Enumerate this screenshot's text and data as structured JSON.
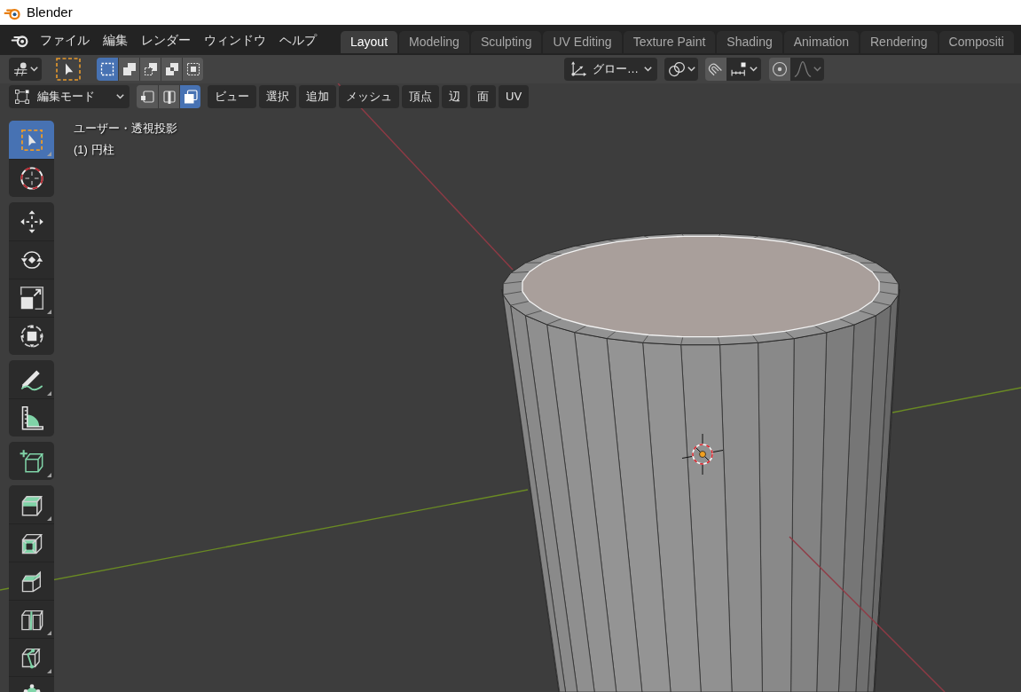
{
  "title_bar": {
    "title": "Blender"
  },
  "top_bar": {
    "menus": [
      "ファイル",
      "編集",
      "レンダー",
      "ウィンドウ",
      "ヘルプ"
    ],
    "workspace_tabs": [
      {
        "label": "Layout",
        "selected": true
      },
      {
        "label": "Modeling",
        "selected": false
      },
      {
        "label": "Sculpting",
        "selected": false
      },
      {
        "label": "UV Editing",
        "selected": false
      },
      {
        "label": "Texture Paint",
        "selected": false
      },
      {
        "label": "Shading",
        "selected": false
      },
      {
        "label": "Animation",
        "selected": false
      },
      {
        "label": "Rendering",
        "selected": false
      },
      {
        "label": "Compositi",
        "selected": false
      }
    ]
  },
  "tool_header": {
    "selection_modes": [
      {
        "kind": "new",
        "selected": true
      },
      {
        "kind": "extend",
        "selected": false
      },
      {
        "kind": "subtract",
        "selected": false
      },
      {
        "kind": "invert",
        "selected": false
      },
      {
        "kind": "intersect",
        "selected": false
      }
    ],
    "transform_orientation": {
      "value": "グロー…"
    },
    "snap": {
      "on": false
    },
    "proportional_editing": {
      "on": false
    },
    "proportional_falloff": {
      "disabled": true
    }
  },
  "view_header": {
    "mode": {
      "value": "編集モード"
    },
    "mesh_select_modes": [
      {
        "kind": "vertex",
        "selected": false
      },
      {
        "kind": "edge",
        "selected": false
      },
      {
        "kind": "face",
        "selected": true
      }
    ],
    "menus": [
      "ビュー",
      "選択",
      "追加",
      "メッシュ",
      "頂点",
      "辺",
      "面",
      "UV"
    ]
  },
  "toolbar": {
    "groups": [
      {
        "tools": [
          {
            "kind": "select_box",
            "selected": true,
            "has_submenu": true
          },
          {
            "kind": "cursor",
            "selected": false,
            "has_submenu": false
          }
        ]
      },
      {
        "tools": [
          {
            "kind": "move",
            "selected": false,
            "has_submenu": false
          },
          {
            "kind": "rotate",
            "selected": false,
            "has_submenu": false
          },
          {
            "kind": "scale",
            "selected": false,
            "has_submenu": true
          },
          {
            "kind": "transform",
            "selected": false,
            "has_submenu": false
          }
        ]
      },
      {
        "tools": [
          {
            "kind": "annotate",
            "selected": false,
            "has_submenu": true
          },
          {
            "kind": "measure",
            "selected": false,
            "has_submenu": false
          }
        ]
      },
      {
        "tools": [
          {
            "kind": "add_cube",
            "selected": false,
            "has_submenu": true
          }
        ]
      },
      {
        "tools": [
          {
            "kind": "extrude",
            "selected": false,
            "has_submenu": true
          },
          {
            "kind": "inset",
            "selected": false,
            "has_submenu": false
          },
          {
            "kind": "bevel",
            "selected": false,
            "has_submenu": false
          },
          {
            "kind": "loop_cut",
            "selected": false,
            "has_submenu": true
          },
          {
            "kind": "knife",
            "selected": false,
            "has_submenu": true
          },
          {
            "kind": "poly_build",
            "selected": false,
            "has_submenu": false
          }
        ]
      }
    ]
  },
  "viewport": {
    "view_name": "ユーザー・透視投影",
    "object_info": "(1) 円柱"
  }
}
